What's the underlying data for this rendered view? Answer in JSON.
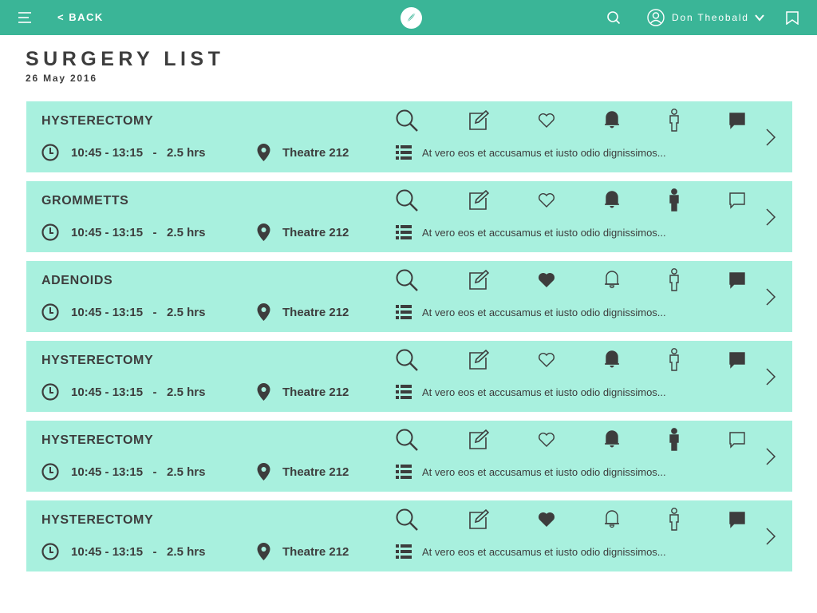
{
  "header": {
    "back_label": "< BACK",
    "user_name": "Don Theobald",
    "icons": [
      "menu-icon",
      "logo-icon",
      "search-icon",
      "user-avatar-icon",
      "chevron-down-icon",
      "bookmark-icon"
    ]
  },
  "page": {
    "title": "SURGERY LIST",
    "date": "26 May 2016"
  },
  "colors": {
    "topbar": "#3ab597",
    "card": "#a8f0de",
    "text": "#3d3d3d"
  },
  "surgeries": [
    {
      "name": "HYSTERECTOMY",
      "time": "10:45 - 13:15   -   2.5 hrs",
      "location": "Theatre 212",
      "note": "At vero eos et accusamus et iusto odio dignissimos...",
      "favorite": false,
      "bell_active": true,
      "person_active": false,
      "message_active": true
    },
    {
      "name": "GROMMETTS",
      "time": "10:45 - 13:15   -   2.5 hrs",
      "location": "Theatre 212",
      "note": "At vero eos et accusamus et iusto odio dignissimos...",
      "favorite": false,
      "bell_active": true,
      "person_active": true,
      "message_active": false
    },
    {
      "name": "ADENOIDS",
      "time": "10:45 - 13:15   -   2.5 hrs",
      "location": "Theatre 212",
      "note": "At vero eos et accusamus et iusto odio dignissimos...",
      "favorite": true,
      "bell_active": false,
      "person_active": false,
      "message_active": true
    },
    {
      "name": "HYSTERECTOMY",
      "time": "10:45 - 13:15   -   2.5 hrs",
      "location": "Theatre 212",
      "note": "At vero eos et accusamus et iusto odio dignissimos...",
      "favorite": false,
      "bell_active": true,
      "person_active": false,
      "message_active": true
    },
    {
      "name": "HYSTERECTOMY",
      "time": "10:45 - 13:15   -   2.5 hrs",
      "location": "Theatre 212",
      "note": "At vero eos et accusamus et iusto odio dignissimos...",
      "favorite": false,
      "bell_active": true,
      "person_active": true,
      "message_active": false
    },
    {
      "name": "HYSTERECTOMY",
      "time": "10:45 - 13:15   -   2.5 hrs",
      "location": "Theatre 212",
      "note": "At vero eos et accusamus et iusto odio dignissimos...",
      "favorite": true,
      "bell_active": false,
      "person_active": false,
      "message_active": true
    }
  ]
}
